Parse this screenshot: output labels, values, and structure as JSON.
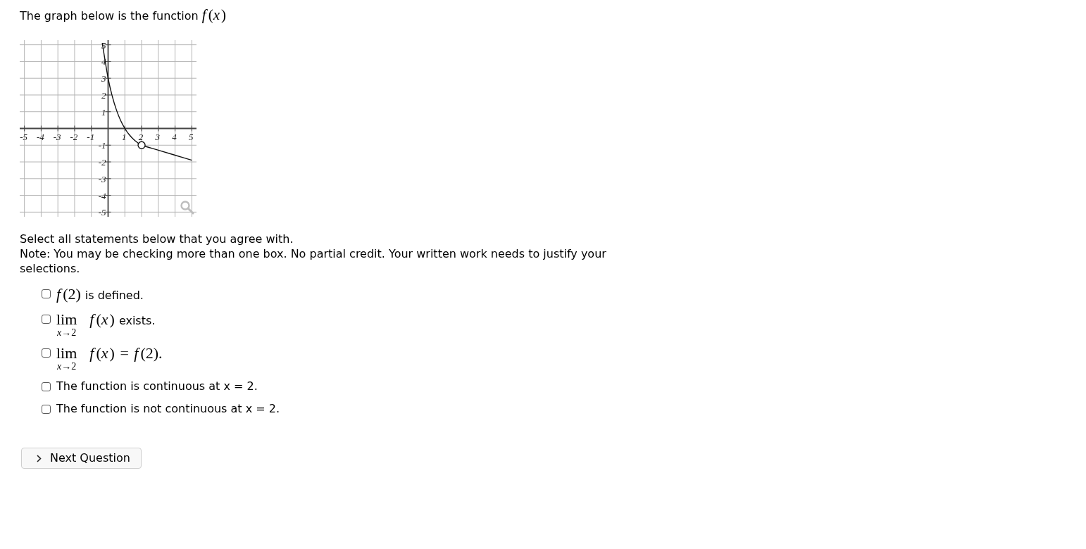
{
  "intro": {
    "text": "The graph below is the function",
    "math": "f(x)"
  },
  "graph": {
    "chart_data": {
      "type": "line",
      "x": [
        -0.35,
        0,
        0.25,
        0.5,
        0.75,
        1,
        1.25,
        1.5,
        1.75,
        2,
        3,
        4,
        5
      ],
      "series": [
        {
          "values": [
            5.11,
            3,
            1.92,
            1.1,
            0.47,
            0,
            -0.36,
            -0.63,
            -0.84,
            -1,
            -1.3,
            -1.6,
            -1.9
          ]
        },
        {
          "values": [
            null,
            null,
            null,
            null,
            null,
            null,
            null,
            null,
            null,
            -1,
            null,
            null,
            null
          ],
          "marker": "open_circle"
        }
      ],
      "xlim": [
        -5.28,
        5.28
      ],
      "ylim": [
        -5.28,
        5.28
      ],
      "xticks": [
        -5,
        -4,
        -3,
        -2,
        -1,
        1,
        2,
        3,
        4,
        5
      ],
      "yticks": [
        -5,
        -4,
        -3,
        -2,
        -1,
        1,
        2,
        3,
        4,
        5
      ],
      "grid": true
    }
  },
  "instructions": [
    "Select all statements below that you agree with.",
    "Note: You may be checking more than one box. No partial credit. Your written work needs to justify your selections."
  ],
  "options": [
    {
      "kind": "math",
      "math": "f(2)",
      "text": "is defined.",
      "checked": false
    },
    {
      "kind": "limit",
      "limit": "lim",
      "limit_sub": "x→2",
      "math": "f(x)",
      "text": "exists.",
      "checked": false
    },
    {
      "kind": "limit",
      "limit": "lim",
      "limit_sub": "x→2",
      "math": "f(x) = f(2).",
      "checked": false
    },
    {
      "kind": "plain",
      "text": "The function is continuous at x = 2.",
      "checked": false
    },
    {
      "kind": "plain",
      "text": "The function is not continuous at x = 2.",
      "checked": false
    }
  ],
  "next_button": {
    "label": "Next Question"
  }
}
